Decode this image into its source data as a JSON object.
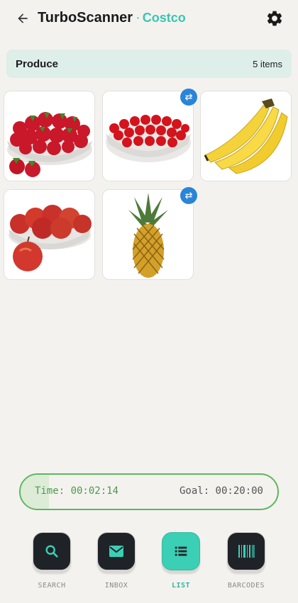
{
  "header": {
    "app_title": "TurboScanner",
    "separator": "·",
    "store_name": "Costco",
    "back_icon": "back-arrow-icon",
    "settings_icon": "gear-icon"
  },
  "section": {
    "title": "Produce",
    "count_label": "5 items"
  },
  "items": [
    {
      "name": "strawberries",
      "has_swap": false
    },
    {
      "name": "cherry-tomatoes",
      "has_swap": true
    },
    {
      "name": "bananas",
      "has_swap": false
    },
    {
      "name": "apples",
      "has_swap": false
    },
    {
      "name": "pineapple",
      "has_swap": true
    }
  ],
  "timer": {
    "elapsed_label": "Time: 00:02:14",
    "goal_label": "Goal: 00:20:00",
    "progress_fraction": 0.11,
    "accent_color": "#5bb85d"
  },
  "nav": {
    "items": [
      {
        "label": "SEARCH",
        "icon": "search-icon",
        "active": false
      },
      {
        "label": "INBOX",
        "icon": "mail-icon",
        "active": false
      },
      {
        "label": "LIST",
        "icon": "list-icon",
        "active": true
      },
      {
        "label": "BARCODES",
        "icon": "barcode-icon",
        "active": false
      }
    ],
    "active_color": "#3bcfb5"
  }
}
